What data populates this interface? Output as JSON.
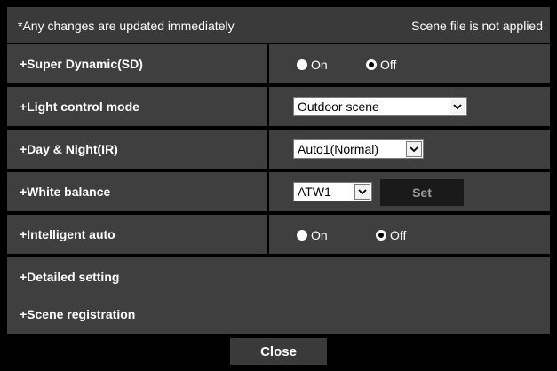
{
  "header": {
    "note": "*Any changes are updated immediately",
    "status": "Scene file is not applied"
  },
  "super_dynamic": {
    "label": "+Super Dynamic(SD)",
    "on_label": "On",
    "off_label": "Off",
    "selected": "Off"
  },
  "light_control": {
    "label": "+Light control mode",
    "value": "Outdoor scene"
  },
  "day_night": {
    "label": "+Day & Night(IR)",
    "value": "Auto1(Normal)"
  },
  "white_balance": {
    "label": "+White balance",
    "value": "ATW1",
    "set_label": "Set"
  },
  "intelligent_auto": {
    "label": "+Intelligent auto",
    "on_label": "On",
    "off_label": "Off",
    "selected": "Off"
  },
  "detailed_setting": {
    "label": "+Detailed setting"
  },
  "scene_registration": {
    "label": "+Scene registration"
  },
  "close_label": "Close"
}
